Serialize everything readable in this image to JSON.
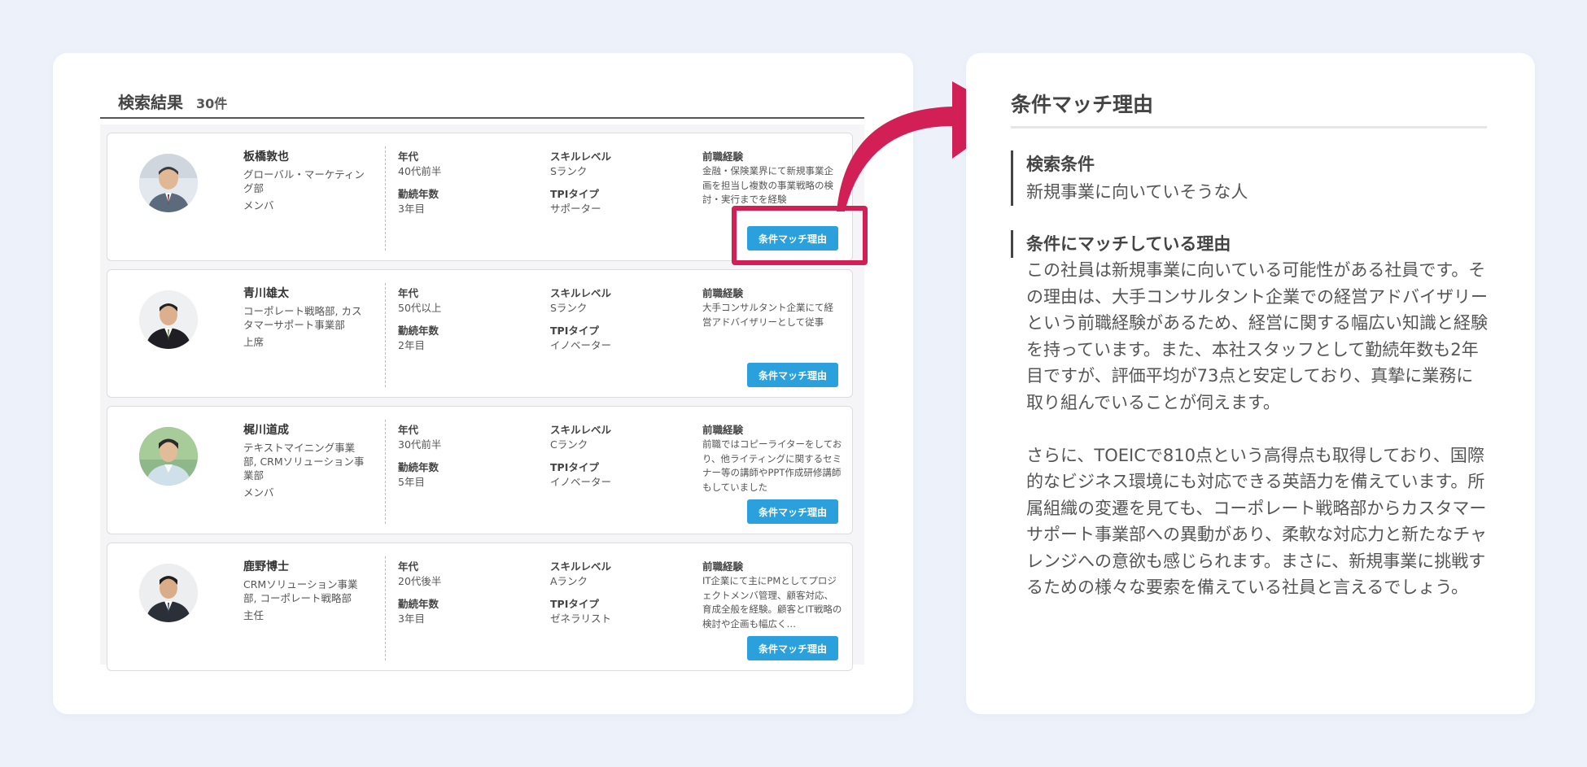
{
  "results": {
    "title": "検索結果",
    "count": "30件",
    "labels": {
      "age": "年代",
      "years": "勤続年数",
      "skill": "スキルレベル",
      "tpi": "TPIタイプ",
      "experience": "前職経験"
    },
    "button_label": "条件マッチ理由",
    "people": [
      {
        "name": "板橋敦也",
        "dept": "グローバル・マーケティング部",
        "role": "メンバ",
        "age": "40代前半",
        "years": "3年目",
        "skill": "Sランク",
        "tpi": "サポーター",
        "experience": "金融・保険業界にて新規事業企画を担当し複数の事業戦略の検討・実行までを経験"
      },
      {
        "name": "青川雄太",
        "dept": "コーポレート戦略部, カスタマーサポート事業部",
        "role": "上席",
        "age": "50代以上",
        "years": "2年目",
        "skill": "Sランク",
        "tpi": "イノベーター",
        "experience": "大手コンサルタント企業にて経営アドバイザリーとして従事"
      },
      {
        "name": "梶川道成",
        "dept": "テキストマイニング事業部, CRMソリューション事業部",
        "role": "メンバ",
        "age": "30代前半",
        "years": "5年目",
        "skill": "Cランク",
        "tpi": "イノベーター",
        "experience": "前職ではコピーライターをしており、他ライティングに関するセミナー等の講師やPPT作成研修講師もしていました"
      },
      {
        "name": "鹿野博士",
        "dept": "CRMソリューション事業部, コーポレート戦略部",
        "role": "主任",
        "age": "20代後半",
        "years": "3年目",
        "skill": "Aランク",
        "tpi": "ゼネラリスト",
        "experience": "IT企業にて主にPMとしてプロジェクトメンバ管理、顧客対応、育成全般を経験。顧客とIT戦略の検討や企画も幅広く…"
      }
    ]
  },
  "reason_panel": {
    "title": "条件マッチ理由",
    "condition_heading": "検索条件",
    "condition_text": "新規事業に向いていそうな人",
    "reason_heading": "条件にマッチしている理由",
    "paragraph1": "この社員は新規事業に向いている可能性がある社員です。その理由は、大手コンサルタント企業での経営アドバイザリーという前職経験があるため、経営に関する幅広い知識と経験を持っています。また、本社スタッフとして勤続年数も2年目ですが、評価平均が73点と安定しており、真摯に業務に取り組んでいることが伺えます。",
    "paragraph2": "さらに、TOEICで810点という高得点も取得しており、国際的なビジネス環境にも対応できる英語力を備えています。所属組織の変遷を見ても、コーポレート戦略部からカスタマーサポート事業部への異動があり、柔軟な対応力と新たなチャレンジへの意欲も感じられます。まさに、新規事業に挑戦するための様々な要索を備えている社員と言えるでしょう。"
  },
  "colors": {
    "accent": "#d21f55",
    "button": "#2aa0dc",
    "background": "#edf2fa"
  }
}
